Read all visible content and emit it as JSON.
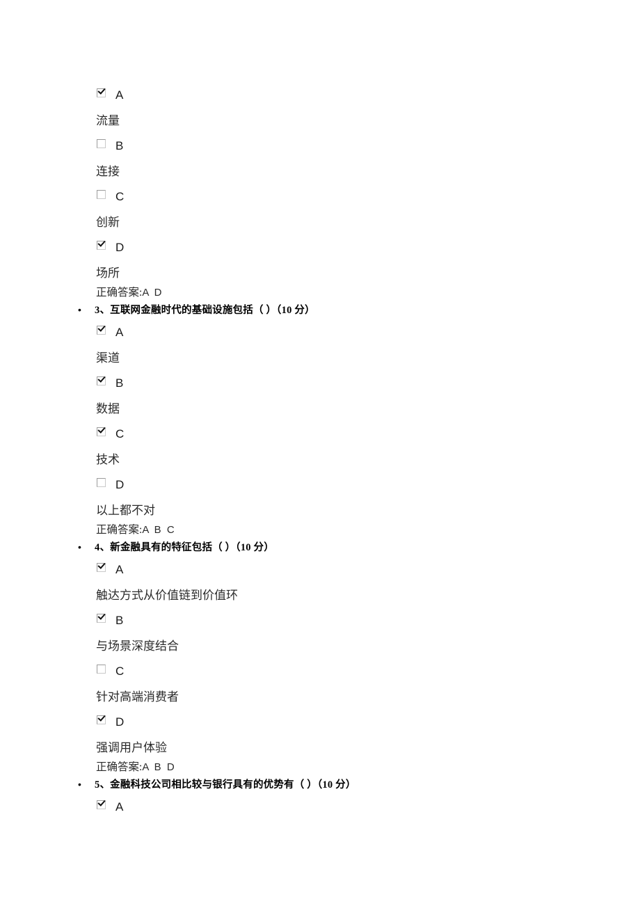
{
  "document": {
    "type": "multiple-choice-exam",
    "language": "zh-CN",
    "answer_label": "正确答案:"
  },
  "questions": [
    {
      "id": "q2-continued",
      "number": "",
      "text": "",
      "partial": true,
      "options": [
        {
          "letter": "A",
          "checked": true,
          "text": "流量"
        },
        {
          "letter": "B",
          "checked": false,
          "text": "连接"
        },
        {
          "letter": "C",
          "checked": false,
          "text": "创新"
        },
        {
          "letter": "D",
          "checked": true,
          "text": "场所"
        }
      ],
      "answer_label": "正确答案:",
      "answer": "A D"
    },
    {
      "id": "q3",
      "bullet": "•",
      "text": "3、互联网金融时代的基础设施包括（ ）（10 分）",
      "partial": false,
      "options": [
        {
          "letter": "A",
          "checked": true,
          "text": "渠道"
        },
        {
          "letter": "B",
          "checked": true,
          "text": "数据"
        },
        {
          "letter": "C",
          "checked": true,
          "text": "技术"
        },
        {
          "letter": "D",
          "checked": false,
          "text": "以上都不对"
        }
      ],
      "answer_label": "正确答案:",
      "answer": "A B C"
    },
    {
      "id": "q4",
      "bullet": "•",
      "text": "4、新金融具有的特征包括（ ）（10 分）",
      "partial": false,
      "options": [
        {
          "letter": "A",
          "checked": true,
          "text": "触达方式从价值链到价值环"
        },
        {
          "letter": "B",
          "checked": true,
          "text": "与场景深度结合"
        },
        {
          "letter": "C",
          "checked": false,
          "text": "针对高端消费者"
        },
        {
          "letter": "D",
          "checked": true,
          "text": "强调用户体验"
        }
      ],
      "answer_label": "正确答案:",
      "answer": "A B D"
    },
    {
      "id": "q5",
      "bullet": "•",
      "text": "5、金融科技公司相比较与银行具有的优势有（ ）（10 分）",
      "partial": true,
      "options": [
        {
          "letter": "A",
          "checked": true,
          "text": ""
        }
      ],
      "answer_label": "",
      "answer": ""
    }
  ]
}
